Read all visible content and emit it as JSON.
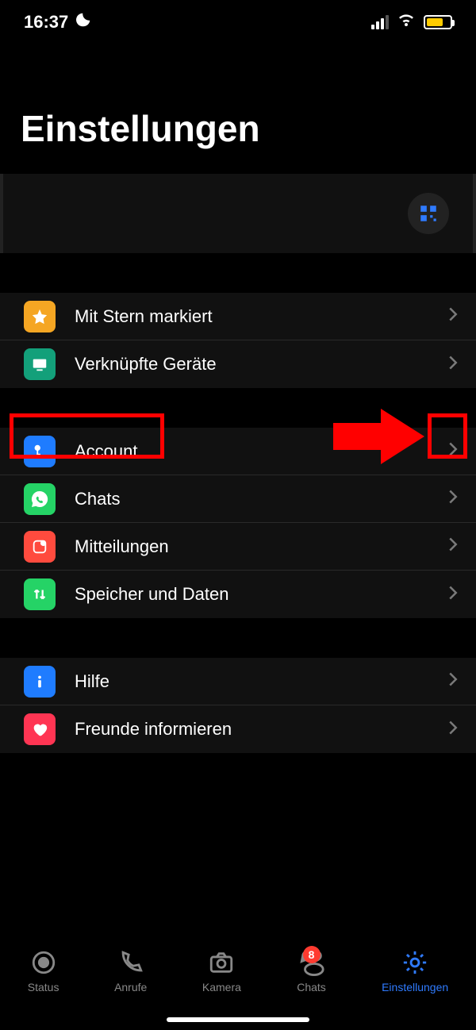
{
  "status": {
    "time": "16:37"
  },
  "header": {
    "title": "Einstellungen"
  },
  "sections": [
    {
      "rows": [
        {
          "icon": "star",
          "label": "Mit Stern markiert",
          "color": "#ffb700"
        },
        {
          "icon": "desktop",
          "label": "Verknüpfte Geräte",
          "color": "#1aa57a"
        }
      ]
    },
    {
      "rows": [
        {
          "icon": "key",
          "label": "Account",
          "color": "#1f7cff"
        },
        {
          "icon": "whatsapp",
          "label": "Chats",
          "color": "#25d366"
        },
        {
          "icon": "notification",
          "label": "Mitteilungen",
          "color": "#ff3b30"
        },
        {
          "icon": "arrows",
          "label": "Speicher und Daten",
          "color": "#25d366"
        }
      ]
    },
    {
      "rows": [
        {
          "icon": "info",
          "label": "Hilfe",
          "color": "#1f7cff"
        },
        {
          "icon": "heart",
          "label": "Freunde informieren",
          "color": "#ff3b5c"
        }
      ]
    }
  ],
  "tabs": [
    {
      "label": "Status",
      "icon": "status"
    },
    {
      "label": "Anrufe",
      "icon": "calls"
    },
    {
      "label": "Kamera",
      "icon": "camera"
    },
    {
      "label": "Chats",
      "icon": "chats",
      "badge": "8"
    },
    {
      "label": "Einstellungen",
      "icon": "settings",
      "active": true
    }
  ]
}
